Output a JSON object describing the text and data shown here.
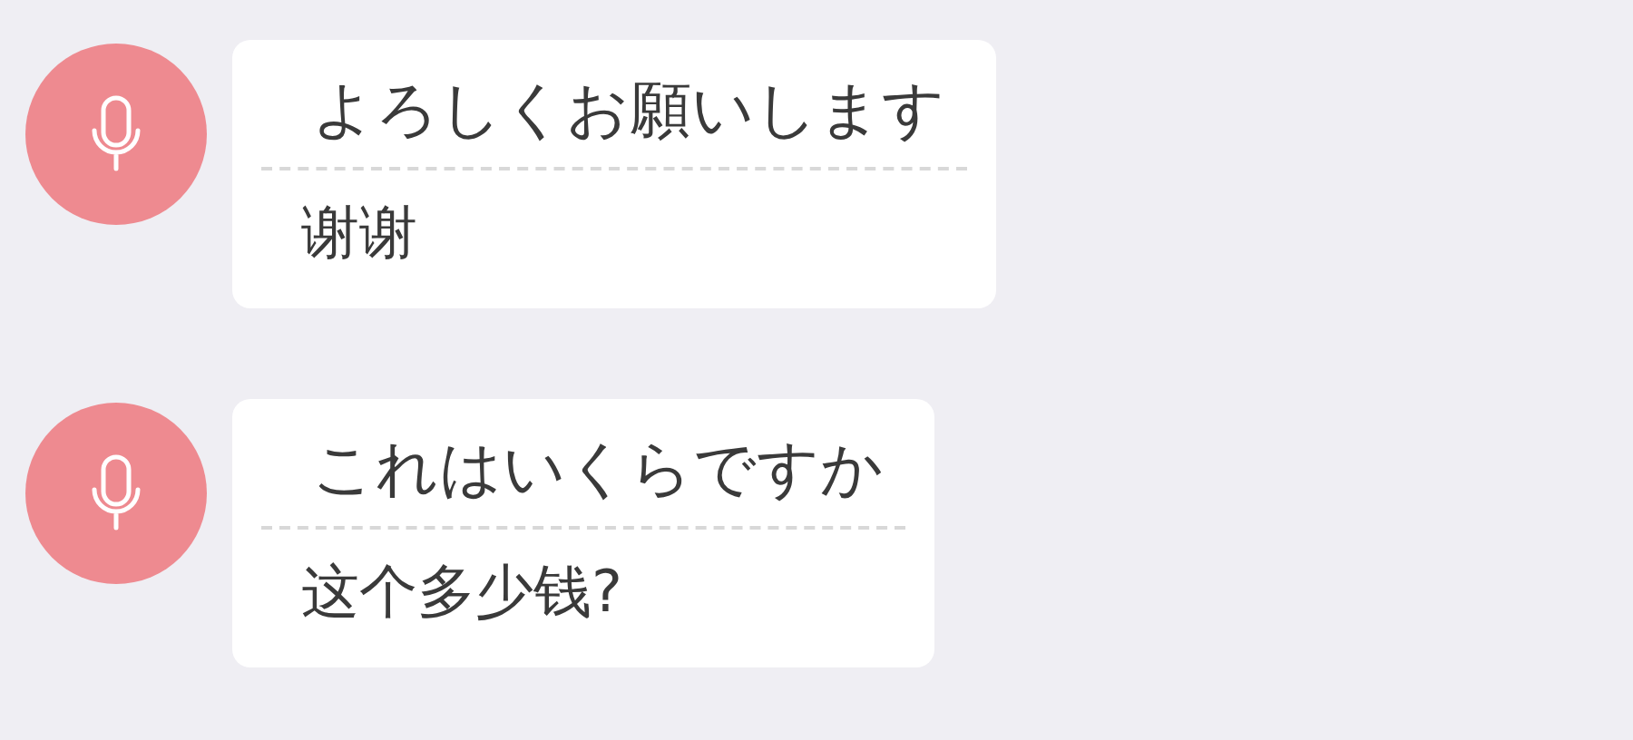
{
  "messages": [
    {
      "original": "よろしくお願いします",
      "translation": "谢谢"
    },
    {
      "original": "これはいくらですか",
      "translation": "这个多少钱?"
    }
  ]
}
